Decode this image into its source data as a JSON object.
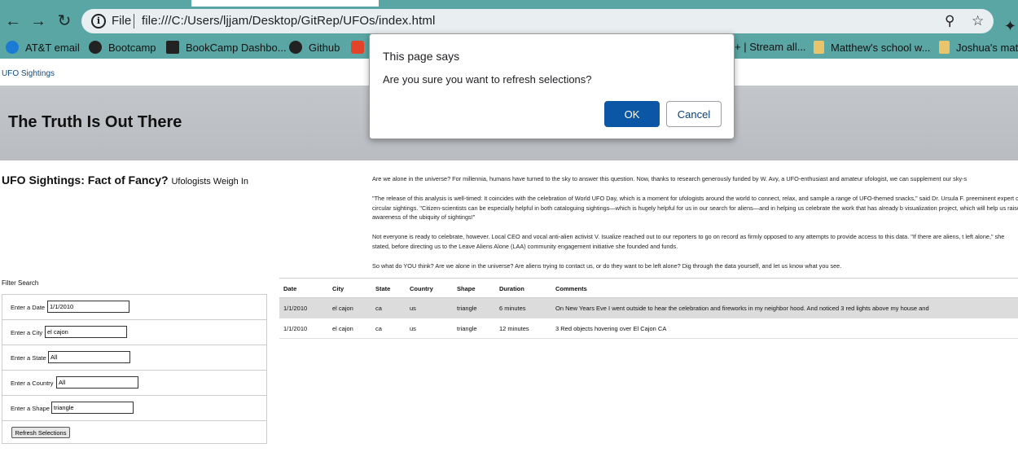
{
  "browser": {
    "url_scheme": "File",
    "url": "file:///C:/Users/ljjam/Desktop/GitRep/UFOs/index.html",
    "back_icon": "back-arrow-icon",
    "forward_icon": "forward-arrow-icon",
    "reload_icon": "reload-icon",
    "info_icon": "info-icon",
    "zoom_icon": "zoom-icon",
    "star_icon": "star-icon",
    "extensions_icon": "puzzle-icon",
    "accent_color": "#5aa6a4"
  },
  "bookmarks": [
    {
      "label": "AT&T email",
      "icon": "att-globe-icon",
      "color": "#1a7ad4"
    },
    {
      "label": "Bootcamp",
      "icon": "globe-icon",
      "color": "#222222"
    },
    {
      "label": "BookCamp Dashbo...",
      "icon": "vanderbilt-icon",
      "color": "#222222"
    },
    {
      "label": "Github",
      "icon": "github-icon",
      "color": "#222222"
    },
    {
      "label": "",
      "icon": "gitlab-icon",
      "color": "#e24329"
    },
    {
      "label": "+ | Stream all...",
      "icon": "",
      "color": ""
    },
    {
      "label": "Matthew's school w...",
      "icon": "folder-icon",
      "color": "#e9c46a"
    },
    {
      "label": "Joshua's math",
      "icon": "folder-icon",
      "color": "#e9c46a"
    }
  ],
  "page": {
    "brand": "UFO Sightings",
    "hero_title": "The Truth Is Out There",
    "article_title": "UFO Sightings: Fact of Fancy?",
    "article_subtitle": "Ufologists Weigh In",
    "paragraphs": [
      "Are we alone in the universe? For millennia, humans have turned to the sky to answer this question. Now, thanks to research generously funded by W. Avy, a UFO-enthusiast and amateur ufologist, we can supplement our sky-s",
      "\"The release of this analysis is well-timed: It coincides with the celebration of World UFO Day, which is a moment for ufologists around the world to connect, relax, and sample a range of UFO-themed snacks,\" said Dr. Ursula F. preeminent expert on circular sightings. \"Citizen-scientists can be especially helpful in both cataloguing sightings—which is hugely helpful for us in our search for aliens—and in helping us celebrate the work that has already b visualization project, which will help us raise awareness of the ubiquity of sightings!\"",
      "Not everyone is ready to celebrate, however. Local CEO and vocal anti-alien activist V. Isualize reached out to our reporters to go on record as firmly opposed to any attempts to provide access to this data. \"If there are aliens, t left alone,\" she stated, before directing us to the Leave Aliens Alone (LAA) community engagement initiative she founded and funds.",
      "So what do YOU think? Are we alone in the universe? Are aliens trying to contact us, or do they want to be left alone? Dig through the data yourself, and let us know what you see."
    ]
  },
  "filters": {
    "heading": "Filter Search",
    "fields": [
      {
        "label": "Enter a Date",
        "value": "1/1/2010"
      },
      {
        "label": "Enter a City",
        "value": "el cajon"
      },
      {
        "label": "Enter a State",
        "value": "All"
      },
      {
        "label": "Enter a Country",
        "value": "All"
      },
      {
        "label": "Enter a Shape",
        "value": "triangle"
      }
    ],
    "refresh_label": "Refresh Selections"
  },
  "table": {
    "headers": [
      "Date",
      "City",
      "State",
      "Country",
      "Shape",
      "Duration",
      "Comments"
    ],
    "rows": [
      [
        "1/1/2010",
        "el cajon",
        "ca",
        "us",
        "triangle",
        "6 minutes",
        "On New Years Eve I went outside to hear the celebration and fireworks in my neighbor hood. And noticed 3 red lights above my house and"
      ],
      [
        "1/1/2010",
        "el cajon",
        "ca",
        "us",
        "triangle",
        "12 minutes",
        "3 Red objects hovering over El Cajon CA"
      ]
    ]
  },
  "dialog": {
    "title": "This page says",
    "message": "Are you sure you want to refresh selections?",
    "ok_label": "OK",
    "cancel_label": "Cancel",
    "ok_color": "#0b57a6"
  }
}
